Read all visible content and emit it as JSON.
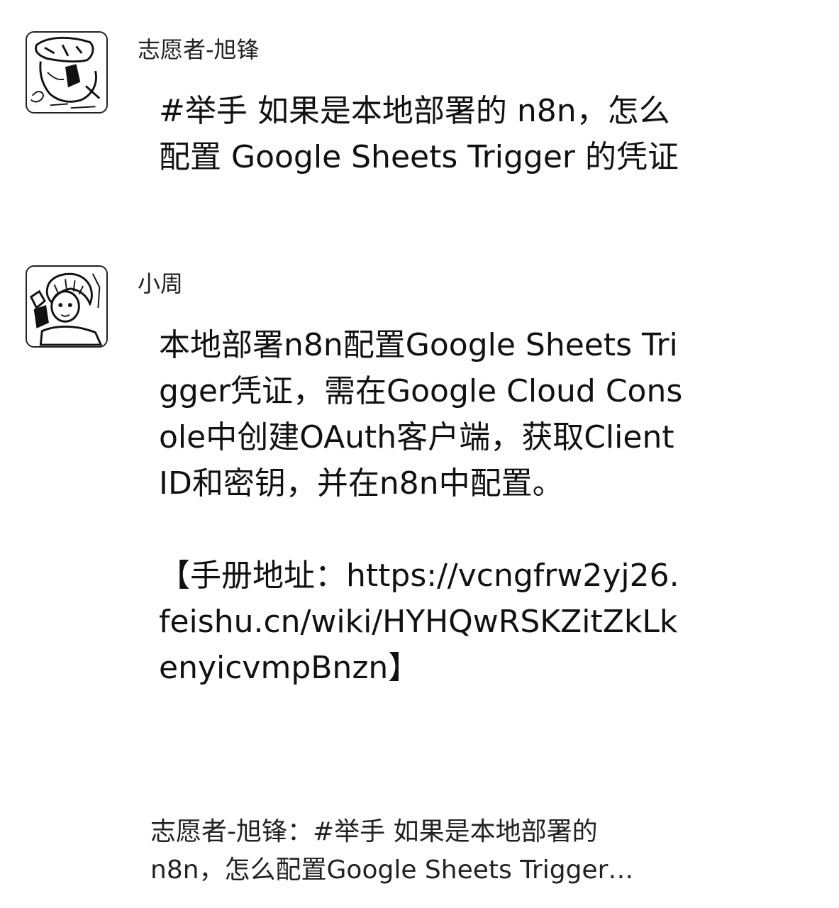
{
  "messages": [
    {
      "sender": "志愿者-旭锋",
      "avatar_icon": "sketch-avatar-icon",
      "text": "#举手 如果是本地部署的 n8n，怎么配置 Google Sheets Trigger 的凭证"
    },
    {
      "sender": "小周",
      "avatar_icon": "anime-avatar-icon",
      "text": "本地部署n8n配置Google Sheets Trigger凭证，需在Google Cloud Console中创建OAuth客户端，获取Client ID和密钥，并在n8n中配置。\n\n【手册地址：https://vcngfrw2yj26.feishu.cn/wiki/HYHQwRSKZitZkLkenyicvmpBnzn】"
    }
  ],
  "quote": {
    "line1": "志愿者-旭锋：#举手 如果是本地部署的",
    "line2": "n8n，怎么配置Google Sheets Trigger…"
  }
}
